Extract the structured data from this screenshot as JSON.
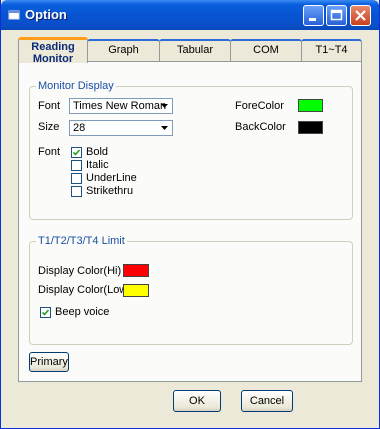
{
  "window": {
    "title": "Option"
  },
  "tabs": [
    {
      "label_line1": "Reading",
      "label_line2": "Monitor"
    },
    {
      "label": "Graph"
    },
    {
      "label": "Tabular"
    },
    {
      "label": "COM"
    },
    {
      "label": "T1~T4"
    }
  ],
  "monitor_display": {
    "title": "Monitor Display",
    "font_label": "Font",
    "font_value": "Times New Roman",
    "size_label": "Size",
    "size_value": "28",
    "style_label": "Font",
    "checkboxes": [
      {
        "label": "Bold",
        "checked": true
      },
      {
        "label": "Italic",
        "checked": false
      },
      {
        "label": "UnderLine",
        "checked": false
      },
      {
        "label": "Strikethru",
        "checked": false
      }
    ],
    "forecolor_label": "ForeColor",
    "forecolor": "#00ff00",
    "backcolor_label": "BackColor",
    "backcolor": "#000000"
  },
  "limit": {
    "title": "T1/T2/T3/T4 Limit",
    "hi_label": "Display Color(Hi)",
    "hi_color": "#ff0000",
    "low_label": "Display Color(Low)",
    "low_color": "#ffff00",
    "beep_label": "Beep voice",
    "beep_checked": true
  },
  "buttons": {
    "primary": "Primary",
    "ok": "OK",
    "cancel": "Cancel"
  },
  "icons": {
    "title": "app-icon",
    "minimize": "minimize-icon",
    "maximize": "maximize-icon",
    "close": "close-icon",
    "dropdown": "chevron-down-icon",
    "check": "check-icon"
  }
}
